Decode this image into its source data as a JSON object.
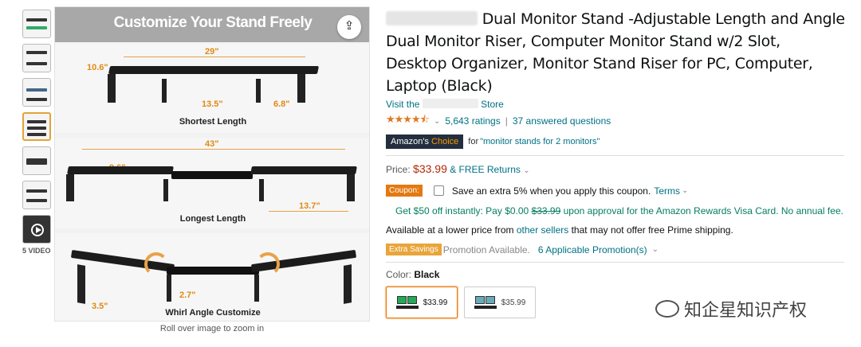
{
  "gallery": {
    "video_label": "5 VIDEO",
    "banner": "Customize Your Stand Freely",
    "share_icon": "share-icon",
    "panels": [
      {
        "caption": "Shortest Length",
        "dims": [
          "29\"",
          "10.6\"",
          "13.5\"",
          "6.8\""
        ]
      },
      {
        "caption": "Longest Length",
        "dims": [
          "43\"",
          "9.6\"",
          "13.7\""
        ]
      },
      {
        "caption": "Whirl Angle Customize",
        "dims": [
          "2.7\"",
          "3.5\""
        ]
      }
    ],
    "rollover": "Roll over image to zoom in"
  },
  "product": {
    "title": "Dual Monitor Stand -Adjustable Length and Angle Dual Monitor Riser, Computer Monitor Stand w/2 Slot, Desktop Organizer, Monitor Stand Riser for PC, Computer, Laptop (Black)",
    "store_prefix": "Visit the",
    "store_suffix": "Store",
    "stars": "★★★★⯪",
    "ratings": "5,643 ratings",
    "separator": "|",
    "answered": "37 answered questions",
    "choice_prefix": "Amazon's",
    "choice_word": "Choice",
    "choice_for": "for",
    "choice_query": "\"monitor stands for 2 monitors\"",
    "price_label": "Price:",
    "price": "$33.99",
    "returns": "& FREE Returns",
    "coupon_label": "Coupon:",
    "coupon_text": "Save an extra 5% when you apply this coupon.",
    "terms": "Terms",
    "visa_text_1": "Get $50 off instantly: Pay $0.00",
    "visa_strike": "$33.99",
    "visa_text_2": "upon approval for the Amazon Rewards Visa Card. No annual fee.",
    "lower_price_1": "Available at a lower price from",
    "other_sellers": "other sellers",
    "lower_price_2": "that may not offer free Prime shipping.",
    "extra_savings": "Extra Savings",
    "promo_available": "Promotion Available.",
    "promotions": "6 Applicable Promotion(s)",
    "color_label": "Color:",
    "color_value": "Black",
    "swatches": [
      {
        "price": "$33.99",
        "selected": true
      },
      {
        "price": "$35.99",
        "selected": false
      }
    ]
  },
  "watermark": "知企星知识产权",
  "colors": {
    "link": "#007185",
    "price": "#b12704",
    "accent": "#e3a33b",
    "stars": "#de7921"
  }
}
